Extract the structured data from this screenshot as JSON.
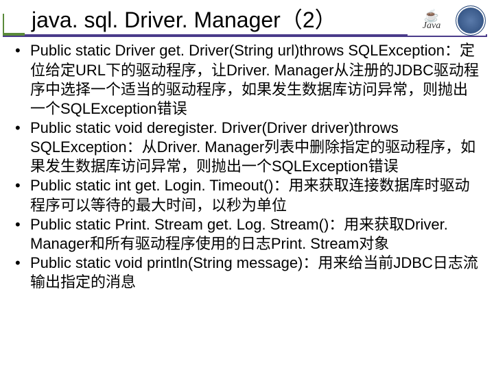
{
  "slide": {
    "title": "java. sql. Driver. Manager（2）",
    "java_label": "Java",
    "bullets": [
      "Public static Driver get. Driver(String url)throws SQLException：定位给定URL下的驱动程序，让Driver. Manager从注册的JDBC驱动程序中选择一个适当的驱动程序，如果发生数据库访问异常，则抛出一个SQLException错误",
      "Public static void deregister. Driver(Driver driver)throws SQLException：从Driver. Manager列表中删除指定的驱动程序，如果发生数据库访问异常，则抛出一个SQLException错误",
      "Public static int get. Login. Timeout()：用来获取连接数据库时驱动程序可以等待的最大时间，以秒为单位",
      "Public static Print. Stream get. Log. Stream()：用来获取Driver. Manager和所有驱动程序使用的日志Print. Stream对象",
      "Public static void println(String message)：用来给当前JDBC日志流输出指定的消息"
    ]
  }
}
